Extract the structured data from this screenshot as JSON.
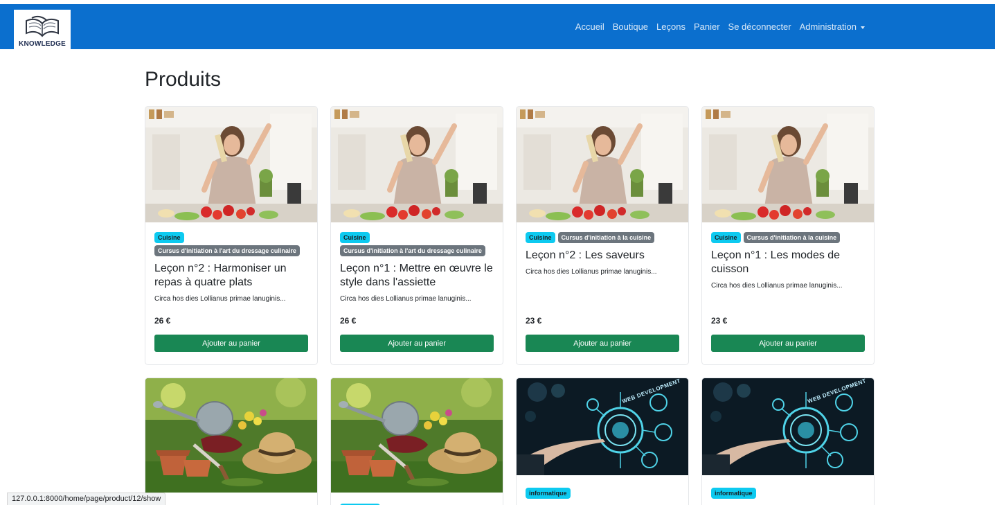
{
  "brand": {
    "text": "KNOWLEDGE"
  },
  "nav": {
    "items": [
      "Accueil",
      "Boutique",
      "Leçons",
      "Panier",
      "Se déconnecter",
      "Administration"
    ]
  },
  "page": {
    "title": "Produits"
  },
  "products": [
    {
      "category": "Cuisine",
      "cursus": "Cursus d'initiation à l'art du dressage culinaire",
      "title": "Leçon n°2 : Harmoniser un repas à quatre plats",
      "excerpt": "Circa hos dies Lollianus primae lanuginis...",
      "price": "26 €",
      "button": "Ajouter au panier",
      "image": "cooking-woman-image"
    },
    {
      "category": "Cuisine",
      "cursus": "Cursus d'initiation à l'art du dressage culinaire",
      "title": "Leçon n°1 : Mettre en œuvre le style dans l'assiette",
      "excerpt": "Circa hos dies Lollianus primae lanuginis...",
      "price": "26 €",
      "button": "Ajouter au panier",
      "image": "cooking-woman-image"
    },
    {
      "category": "Cuisine",
      "cursus": "Cursus d'initiation à la cuisine",
      "title": "Leçon n°2 : Les saveurs",
      "excerpt": "Circa hos dies Lollianus primae lanuginis...",
      "price": "23 €",
      "button": "Ajouter au panier",
      "image": "cooking-woman-image"
    },
    {
      "category": "Cuisine",
      "cursus": "Cursus d'initiation à la cuisine",
      "title": "Leçon n°1 : Les modes de cuisson",
      "excerpt": "Circa hos dies Lollianus primae lanuginis...",
      "price": "23 €",
      "button": "Ajouter au panier",
      "image": "cooking-woman-image"
    }
  ],
  "products_row2": [
    {
      "image": "gardening-image",
      "category": ""
    },
    {
      "image": "gardening-image",
      "category": ""
    },
    {
      "image": "web-development-image",
      "category": "informatique",
      "image_text": "WEB DEVELOPMENT"
    },
    {
      "image": "web-development-image",
      "category": "informatique",
      "image_text": "WEB DEVELOPMENT"
    }
  ],
  "statusbar": {
    "url": "127.0.0.1:8000/home/page/product/12/show"
  },
  "colors": {
    "navbar": "#0b6fce",
    "badge_category": "#0dcaf0",
    "badge_cursus": "#6c757d",
    "button": "#198754"
  }
}
